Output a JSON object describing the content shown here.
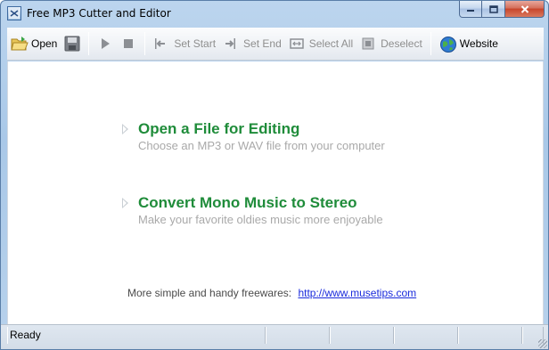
{
  "window": {
    "title": "Free MP3 Cutter and Editor",
    "icon": "app-icon",
    "controls": {
      "minimize": "minimize-icon",
      "maximize": "maximize-icon",
      "close": "close-icon"
    }
  },
  "toolbar": {
    "open_label": "Open",
    "save_icon": "save-icon",
    "play_icon": "play-icon",
    "stop_icon": "stop-icon",
    "set_start_label": "Set Start",
    "set_end_label": "Set End",
    "select_all_label": "Select All",
    "deselect_label": "Deselect",
    "website_label": "Website"
  },
  "main": {
    "actions": [
      {
        "title": "Open a File for Editing",
        "subtitle": "Choose an MP3 or WAV file from your computer"
      },
      {
        "title": "Convert Mono Music to Stereo",
        "subtitle": "Make your favorite oldies music more enjoyable"
      }
    ],
    "footer_text": "More simple and handy freewares:",
    "footer_link": "http://www.musetips.com"
  },
  "status": {
    "text": "Ready"
  },
  "colors": {
    "accent_green": "#1f8c3a",
    "link_blue": "#1a2bdc",
    "subtitle_gray": "#a9a9a9"
  }
}
